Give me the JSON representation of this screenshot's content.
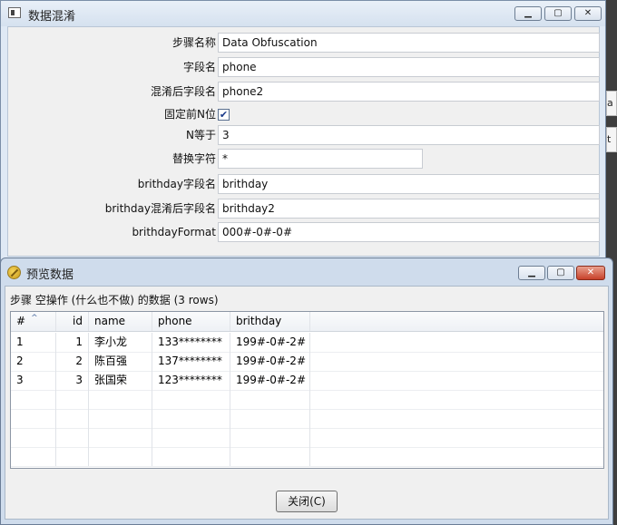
{
  "back_window": {
    "title": "数据混淆",
    "fields": [
      {
        "label": "步骤名称",
        "value": "Data Obfuscation"
      },
      {
        "label": "字段名",
        "value": "phone"
      },
      {
        "label": "混淆后字段名",
        "value": "phone2"
      },
      {
        "label": "固定前N位",
        "checked": true
      },
      {
        "label": "N等于",
        "value": "3"
      },
      {
        "label": "替换字符",
        "value": "*"
      },
      {
        "label": "brithday字段名",
        "value": "brithday"
      },
      {
        "label": "brithday混淆后字段名",
        "value": "brithday2"
      },
      {
        "label": "brithdayFormat",
        "value": "000#-0#-0#"
      }
    ]
  },
  "right_strip": {
    "t1": "a",
    "t2": "t"
  },
  "preview_dialog": {
    "title": "预览数据",
    "caption": "步骤 空操作 (什么也不做) 的数据  (3 rows)",
    "columns": [
      "#",
      "id",
      "name",
      "phone",
      "brithday"
    ],
    "rows": [
      [
        "1",
        "1",
        "李小龙",
        "133********",
        "199#-0#-2#"
      ],
      [
        "2",
        "2",
        "陈百强",
        "137********",
        "199#-0#-2#"
      ],
      [
        "3",
        "3",
        "张国荣",
        "123********",
        "199#-0#-2#"
      ]
    ],
    "close_button": "关闭(C)"
  }
}
